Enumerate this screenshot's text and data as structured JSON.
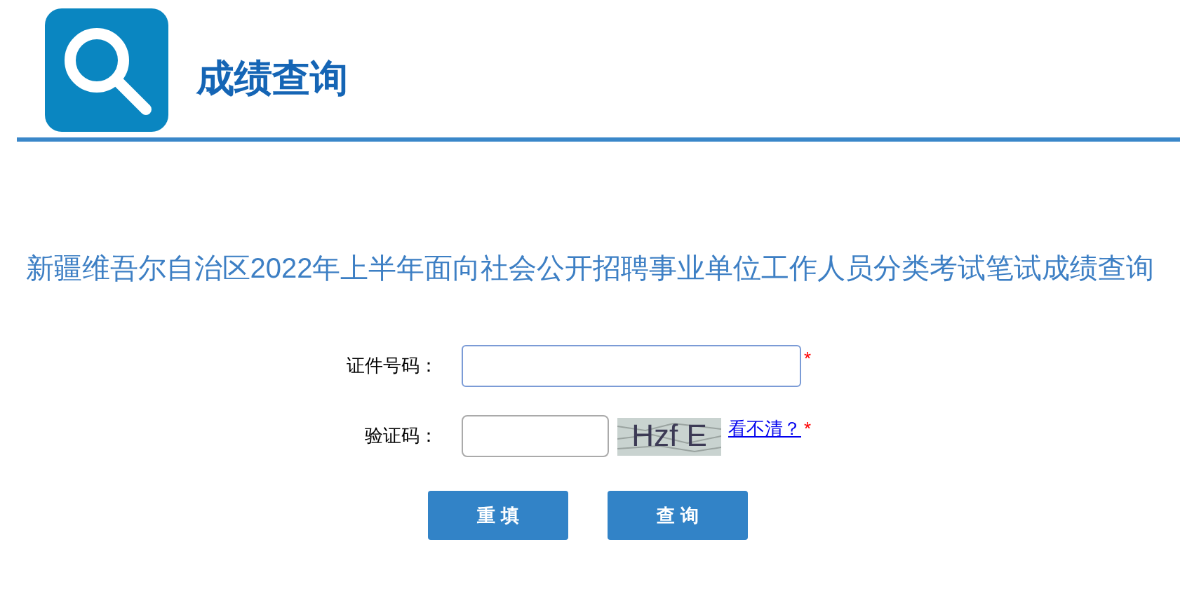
{
  "header": {
    "title": "成绩查询"
  },
  "heading": "新疆维吾尔自治区2022年上半年面向社会公开招聘事业单位工作人员分类考试笔试成绩查询",
  "form": {
    "fields": [
      {
        "kind": "text",
        "label": "证件号码：",
        "required_mark": "*"
      },
      {
        "kind": "captcha",
        "label": "验证码：",
        "captcha": "Hzf E",
        "refresh_link": "看不清？",
        "required_mark": "*"
      }
    ],
    "buttons": [
      "重 填",
      "查 询"
    ]
  }
}
